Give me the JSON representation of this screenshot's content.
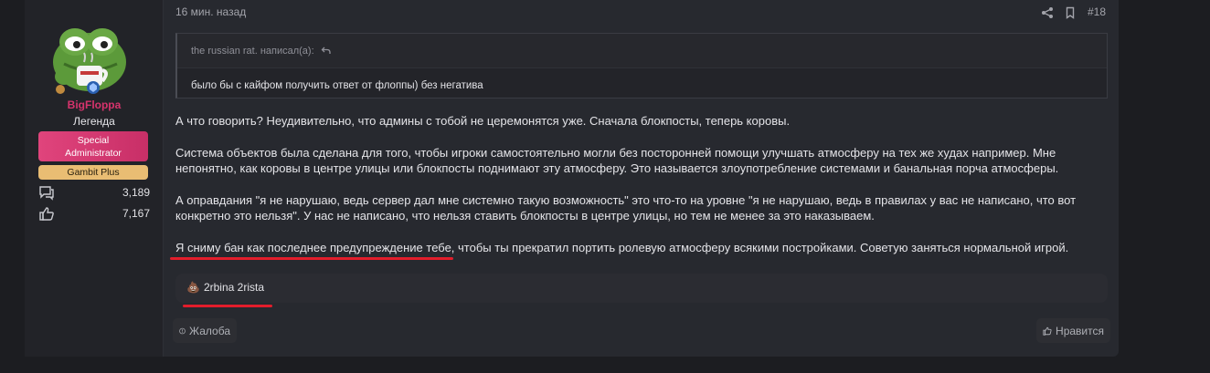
{
  "user": {
    "username": "BigFloppa",
    "user_title": "Легенда",
    "banners": [
      "Special Administrator",
      "Gambit Plus"
    ],
    "stats": [
      {
        "icon": "messages-icon",
        "value": "3,189"
      },
      {
        "icon": "thumbs-up-icon",
        "value": "7,167"
      }
    ]
  },
  "post": {
    "time": "16 мин. назад",
    "number": "#18"
  },
  "quote": {
    "author_line": "the russian rat. написал(а):",
    "text": "было бы с кайфом получить ответ от флоппы) без негатива"
  },
  "message": {
    "paragraphs": [
      "А что говорить? Неудивительно, что админы с тобой не церемонятся уже. Сначала блокпосты, теперь коровы.",
      "Система объектов была сделана для того, чтобы игроки самостоятельно могли без посторонней помощи улучшать атмосферу на тех же худах например. Мне непонятно, как коровы в центре улицы или блокпосты поднимают эту атмосферу. Это называется злоупотребление системами и банальная порча атмосферы.",
      "А оправдания \"я не нарушаю, ведь сервер дал мне системно такую возможность\" это что-то на уровне \"я не нарушаю, ведь в правилах у вас не написано, что вот конкретно это нельзя\". У нас не написано, что нельзя ставить блокпосты в центре улицы, но тем не менее за это наказываем.",
      "Я сниму бан как последнее предупреждение тебе, чтобы ты прекратил портить ролевую атмосферу всякими постройками. Советую заняться нормальной игрой."
    ]
  },
  "reactions": {
    "emoji": "💩",
    "users": "2rbina 2rista"
  },
  "actions": {
    "report_label": "Жалоба",
    "like_label": "Нравится"
  },
  "colors": {
    "username": "#d6336c",
    "special_banner": "#d63a72",
    "gambit_banner": "#e9bd73",
    "annotation_underline": "#e21d2b"
  }
}
